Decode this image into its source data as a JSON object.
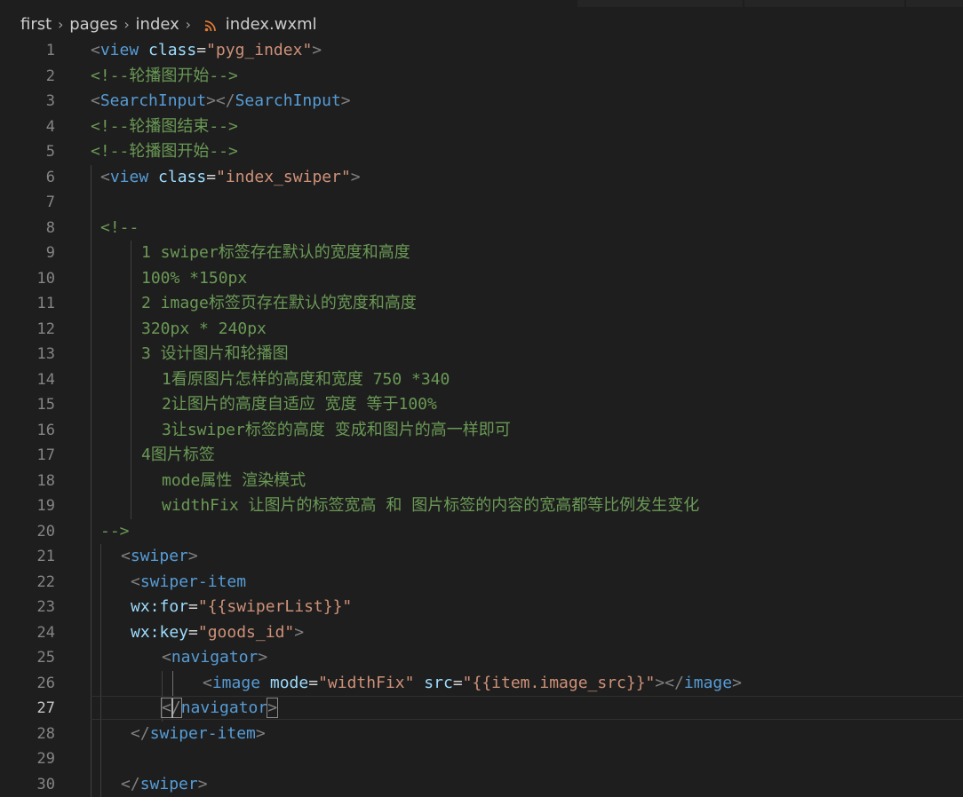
{
  "breadcrumb": {
    "items": [
      "first",
      "pages",
      "index"
    ],
    "file": "index.wxml",
    "file_icon": "rss-icon",
    "file_icon_color": "#e37933"
  },
  "editor": {
    "current_line": 27,
    "lines": [
      {
        "n": "1",
        "indent": 102,
        "tokens": [
          [
            "b",
            "<"
          ],
          [
            "tag",
            "view"
          ],
          [
            "t",
            " "
          ],
          [
            "attr",
            "class"
          ],
          [
            "t",
            "="
          ],
          [
            "str",
            "\"pyg_index\""
          ],
          [
            "b",
            ">"
          ]
        ]
      },
      {
        "n": "2",
        "indent": 102,
        "tokens": [
          [
            "cmt",
            "<!--轮播图开始-->"
          ]
        ]
      },
      {
        "n": "3",
        "indent": 102,
        "tokens": [
          [
            "b",
            "<"
          ],
          [
            "tag",
            "SearchInput"
          ],
          [
            "b",
            "></"
          ],
          [
            "tag",
            "SearchInput"
          ],
          [
            "b",
            ">"
          ]
        ]
      },
      {
        "n": "4",
        "indent": 102,
        "tokens": [
          [
            "cmt",
            "<!--轮播图结束-->"
          ]
        ]
      },
      {
        "n": "5",
        "indent": 102,
        "tokens": [
          [
            "cmt",
            "<!--轮播图开始-->"
          ]
        ]
      },
      {
        "n": "6",
        "indent": 113,
        "tokens": [
          [
            "b",
            "<"
          ],
          [
            "tag",
            "view"
          ],
          [
            "t",
            " "
          ],
          [
            "attr",
            "class"
          ],
          [
            "t",
            "="
          ],
          [
            "str",
            "\"index_swiper\""
          ],
          [
            "b",
            ">"
          ]
        ]
      },
      {
        "n": "7",
        "indent": 113,
        "tokens": []
      },
      {
        "n": "8",
        "indent": 113,
        "tokens": [
          [
            "cmt",
            "<!--"
          ]
        ]
      },
      {
        "n": "9",
        "indent": 159,
        "tokens": [
          [
            "cmt",
            "1 swiper标签存在默认的宽度和高度"
          ]
        ]
      },
      {
        "n": "10",
        "indent": 159,
        "tokens": [
          [
            "cmt",
            "100% *150px"
          ]
        ]
      },
      {
        "n": "11",
        "indent": 159,
        "tokens": [
          [
            "cmt",
            "2 image标签页存在默认的宽度和高度"
          ]
        ]
      },
      {
        "n": "12",
        "indent": 159,
        "tokens": [
          [
            "cmt",
            "320px * 240px"
          ]
        ]
      },
      {
        "n": "13",
        "indent": 159,
        "tokens": [
          [
            "cmt",
            "3 设计图片和轮播图"
          ]
        ]
      },
      {
        "n": "14",
        "indent": 182,
        "tokens": [
          [
            "cmt",
            "1看原图片怎样的高度和宽度 750 *340"
          ]
        ]
      },
      {
        "n": "15",
        "indent": 182,
        "tokens": [
          [
            "cmt",
            "2让图片的高度自适应 宽度 等于100%"
          ]
        ]
      },
      {
        "n": "16",
        "indent": 182,
        "tokens": [
          [
            "cmt",
            "3让swiper标签的高度 变成和图片的高一样即可"
          ]
        ]
      },
      {
        "n": "17",
        "indent": 159,
        "tokens": [
          [
            "cmt",
            "4图片标签"
          ]
        ]
      },
      {
        "n": "18",
        "indent": 182,
        "tokens": [
          [
            "cmt",
            "mode属性 渲染模式"
          ]
        ]
      },
      {
        "n": "19",
        "indent": 182,
        "tokens": [
          [
            "cmt",
            "widthFix 让图片的标签宽高 和 图片标签的内容的宽高都等比例发生变化"
          ]
        ]
      },
      {
        "n": "20",
        "indent": 113,
        "tokens": [
          [
            "cmt",
            "-->"
          ]
        ]
      },
      {
        "n": "21",
        "indent": 136,
        "tokens": [
          [
            "b",
            "<"
          ],
          [
            "tag",
            "swiper"
          ],
          [
            "b",
            ">"
          ]
        ]
      },
      {
        "n": "22",
        "indent": 147,
        "tokens": [
          [
            "b",
            "<"
          ],
          [
            "tag",
            "swiper-item"
          ]
        ]
      },
      {
        "n": "23",
        "indent": 147,
        "tokens": [
          [
            "attr",
            "wx:for"
          ],
          [
            "t",
            "="
          ],
          [
            "str",
            "\"{{swiperList}}\""
          ]
        ]
      },
      {
        "n": "24",
        "indent": 147,
        "tokens": [
          [
            "attr",
            "wx:key"
          ],
          [
            "t",
            "="
          ],
          [
            "str",
            "\"goods_id\""
          ],
          [
            "b",
            ">"
          ]
        ]
      },
      {
        "n": "25",
        "indent": 182,
        "tokens": [
          [
            "b",
            "<"
          ],
          [
            "tag",
            "navigator"
          ],
          [
            "b",
            ">"
          ]
        ]
      },
      {
        "n": "26",
        "indent": 228,
        "tokens": [
          [
            "b",
            "<"
          ],
          [
            "tag",
            "image"
          ],
          [
            "t",
            " "
          ],
          [
            "attr",
            "mode"
          ],
          [
            "t",
            "="
          ],
          [
            "str",
            "\"widthFix\""
          ],
          [
            "t",
            " "
          ],
          [
            "attr",
            "src"
          ],
          [
            "t",
            "="
          ],
          [
            "str",
            "\"{{item.image_src}}\""
          ],
          [
            "b",
            "></"
          ],
          [
            "tag",
            "image"
          ],
          [
            "b",
            ">"
          ]
        ]
      },
      {
        "n": "27",
        "indent": 182,
        "tokens": [
          [
            "b",
            "</"
          ],
          [
            "tag",
            "navigator"
          ],
          [
            "b",
            ">"
          ]
        ]
      },
      {
        "n": "28",
        "indent": 147,
        "tokens": [
          [
            "b",
            "</"
          ],
          [
            "tag",
            "swiper-item"
          ],
          [
            "b",
            ">"
          ]
        ]
      },
      {
        "n": "29",
        "indent": 147,
        "tokens": []
      },
      {
        "n": "30",
        "indent": 136,
        "tokens": [
          [
            "b",
            "</"
          ],
          [
            "tag",
            "swiper"
          ],
          [
            "b",
            ">"
          ]
        ]
      }
    ]
  },
  "colors": {
    "background": "#1e1e1e",
    "tag": "#569cd6",
    "attribute": "#9cdcfe",
    "string": "#ce9178",
    "comment": "#6a9955",
    "bracket": "#808080",
    "line_number": "#858585"
  }
}
